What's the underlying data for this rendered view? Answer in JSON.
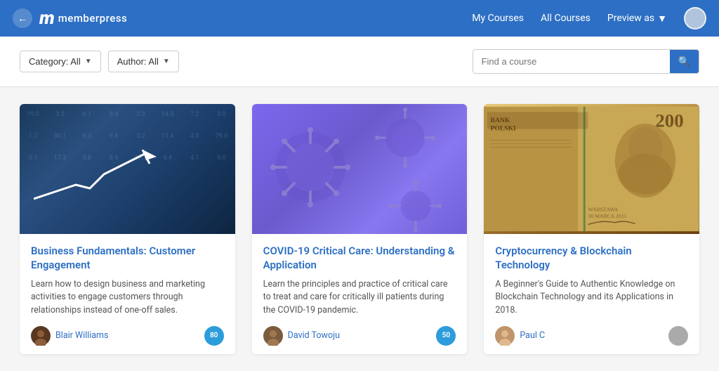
{
  "header": {
    "logo_m": "m",
    "logo_text": "memberpress",
    "nav": {
      "my_courses": "My Courses",
      "all_courses": "All Courses",
      "preview_as": "Preview as"
    }
  },
  "filters": {
    "category_label": "Category: All",
    "author_label": "Author: All",
    "search_placeholder": "Find a course"
  },
  "courses": [
    {
      "id": "business-fundamentals",
      "title": "Business Fundamentals: Customer Engagement",
      "description": "Learn how to design business and marketing activities to engage customers through relationships instead of one-off sales.",
      "author": "Blair Williams",
      "lessons": "80",
      "thumb_type": "finance"
    },
    {
      "id": "covid-critical-care",
      "title": "COVID-19 Critical Care: Understanding & Application",
      "description": "Learn the principles and practice of critical care to treat and care for critically ill patients during the COVID-19 pandemic.",
      "author": "David Towoju",
      "lessons": "50",
      "thumb_type": "covid"
    },
    {
      "id": "crypto-blockchain",
      "title": "Cryptocurrency & Blockchain Technology",
      "description": "A Beginner's Guide to Authentic Knowledge on Blockchain Technology and its Applications in 2018.",
      "author": "Paul C",
      "lessons": "",
      "thumb_type": "crypto"
    }
  ],
  "colors": {
    "brand_blue": "#2d6fc4",
    "header_bg": "#2d6fc4"
  }
}
